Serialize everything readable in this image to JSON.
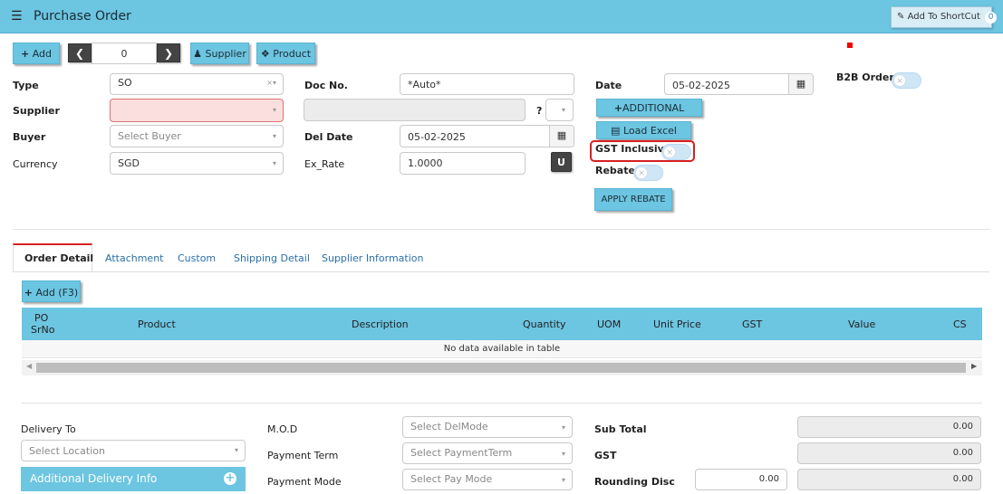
{
  "header": {
    "menu_icon": "hamburger-icon",
    "title": "Purchase Order",
    "shortcut_label": "Add To ShortCut",
    "shortcut_count": "0"
  },
  "toolbar": {
    "add_label": "Add",
    "record_value": "0",
    "supplier_label": "Supplier",
    "product_label": "Product"
  },
  "form": {
    "type_label": "Type",
    "type_value": "SO",
    "supplier_label": "Supplier",
    "buyer_label": "Buyer",
    "buyer_placeholder": "Select Buyer",
    "currency_label": "Currency",
    "currency_value": "SGD",
    "docno_label": "Doc No.",
    "docno_value": "*Auto*",
    "supplier_extra_q": "?",
    "deldate_label": "Del Date",
    "deldate_value": "05-02-2025",
    "exrate_label": "Ex_Rate",
    "exrate_value": "1.0000",
    "u_button": "U",
    "date_label": "Date",
    "date_value": "05-02-2025",
    "additional_button": "ADDITIONAL",
    "load_excel_button": "Load Excel",
    "gst_inclusive_label": "GST Inclusive",
    "rebate_label": "Rebate",
    "apply_rebate_button": "APPLY REBATE",
    "b2b_label": "B2B Order"
  },
  "tabs": [
    "Order Detail",
    "Attachment",
    "Custom",
    "Shipping Detail",
    "Supplier Information"
  ],
  "detail": {
    "add_label": "Add (F3)",
    "columns": {
      "po": "PO",
      "srno": "SrNo",
      "product": "Product",
      "description": "Description",
      "quantity": "Quantity",
      "uom": "UOM",
      "unit_price": "Unit Price",
      "gst": "GST",
      "value": "Value",
      "cs": "CS"
    },
    "empty_text": "No data available in table"
  },
  "footer": {
    "delivery_to_label": "Delivery To",
    "location_placeholder": "Select Location",
    "additional_delivery_label": "Additional Delivery Info",
    "mod_label": "M.O.D",
    "mod_placeholder": "Select DelMode",
    "payment_term_label": "Payment Term",
    "payment_term_placeholder": "Select PaymentTerm",
    "payment_mode_label": "Payment Mode",
    "payment_mode_placeholder": "Select Pay Mode",
    "subtotal_label": "Sub Total",
    "subtotal_value": "0.00",
    "gst_label": "GST",
    "gst_value": "0.00",
    "rounding_label": "Rounding Disc",
    "rounding_input": "0.00",
    "rounding_value": "0.00"
  }
}
